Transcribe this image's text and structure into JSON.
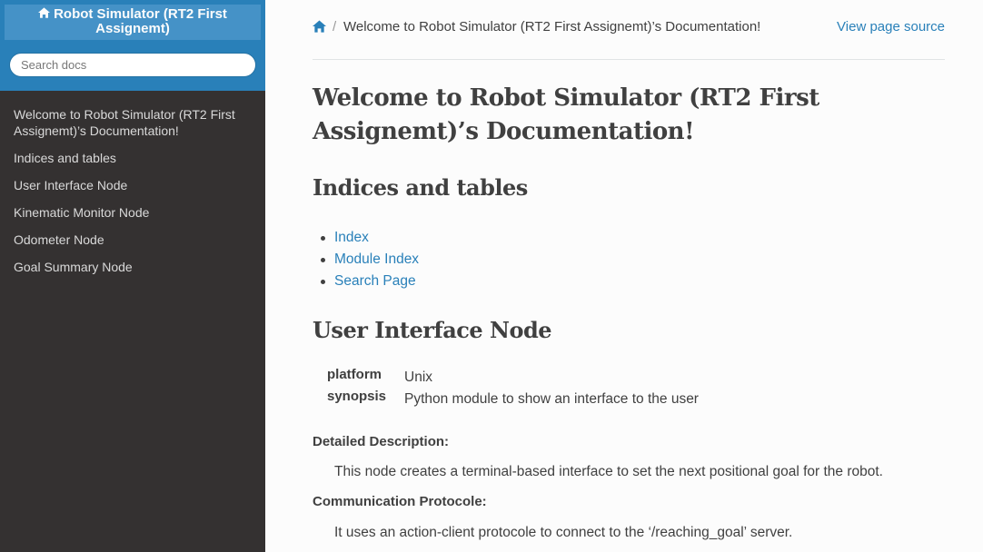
{
  "sidebar": {
    "project_title": "Robot Simulator (RT2 First Assignemt)",
    "search_placeholder": "Search docs",
    "nav_items": [
      "Welcome to Robot Simulator (RT2 First Assignemt)’s Documentation!",
      "Indices and tables",
      "User Interface Node",
      "Kinematic Monitor Node",
      "Odometer Node",
      "Goal Summary Node"
    ]
  },
  "breadcrumbs": {
    "separator": "/",
    "current": "Welcome to Robot Simulator (RT2 First Assignemt)’s Documentation!",
    "view_source": "View page source"
  },
  "main": {
    "title": "Welcome to Robot Simulator (RT2 First Assignemt)’s Documentation!",
    "indices_heading": "Indices and tables",
    "index_links": [
      "Index",
      "Module Index",
      "Search Page"
    ],
    "ui_heading": "User Interface Node",
    "fields": [
      {
        "name": "platform",
        "value": "Unix"
      },
      {
        "name": "synopsis",
        "value": "Python module to show an interface to the user"
      }
    ],
    "detailed_description_label": "Detailed Description:",
    "detailed_description": "This node creates a terminal-based interface to set the next positional goal for the robot.",
    "communication_label": "Communication Protocole:",
    "communication": "It uses an action-client protocole to connect to the ‘/reaching_goal’ server."
  },
  "colors": {
    "sidebar_bg": "#343131",
    "sidebar_top": "#2980b9",
    "link": "#2980b9",
    "text": "#404040"
  },
  "icons": [
    "home-icon"
  ]
}
